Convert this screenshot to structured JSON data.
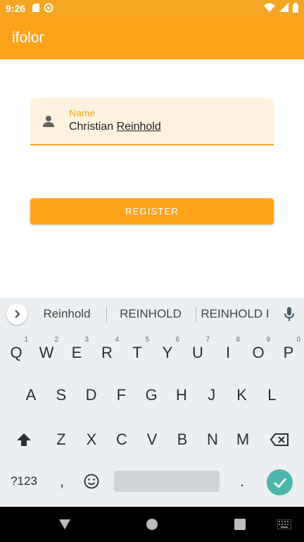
{
  "status_bar": {
    "time": "9:26",
    "icons": [
      "sd-card-icon",
      "sync-icon",
      "wifi-icon",
      "signal-icon",
      "battery-icon"
    ]
  },
  "app_bar": {
    "title": "ifolor"
  },
  "form": {
    "name_field": {
      "label": "Name",
      "value_first": "Christian",
      "value_last": "Reinhold",
      "icon": "person-icon"
    },
    "register_label": "REGISTER"
  },
  "keyboard": {
    "suggestions": [
      "Reinhold",
      "REINHOLD",
      "REINHOLD I"
    ],
    "row1": [
      {
        "label": "Q",
        "hint": "1"
      },
      {
        "label": "W",
        "hint": "2"
      },
      {
        "label": "E",
        "hint": "3"
      },
      {
        "label": "R",
        "hint": "4"
      },
      {
        "label": "T",
        "hint": "5"
      },
      {
        "label": "Y",
        "hint": "6"
      },
      {
        "label": "U",
        "hint": "7"
      },
      {
        "label": "I",
        "hint": "8"
      },
      {
        "label": "O",
        "hint": "9"
      },
      {
        "label": "P",
        "hint": "0"
      }
    ],
    "row2": [
      "A",
      "S",
      "D",
      "F",
      "G",
      "H",
      "J",
      "K",
      "L"
    ],
    "row3": [
      "Z",
      "X",
      "C",
      "V",
      "B",
      "N",
      "M"
    ],
    "bottom": {
      "symbols": "?123",
      "comma": ",",
      "period": "."
    }
  },
  "colors": {
    "status_bar": "#f5a623",
    "app_bar": "#ffa31a",
    "field_bg": "#fff3e0",
    "accent": "#f5a623",
    "enter_key": "#4db6ac"
  }
}
